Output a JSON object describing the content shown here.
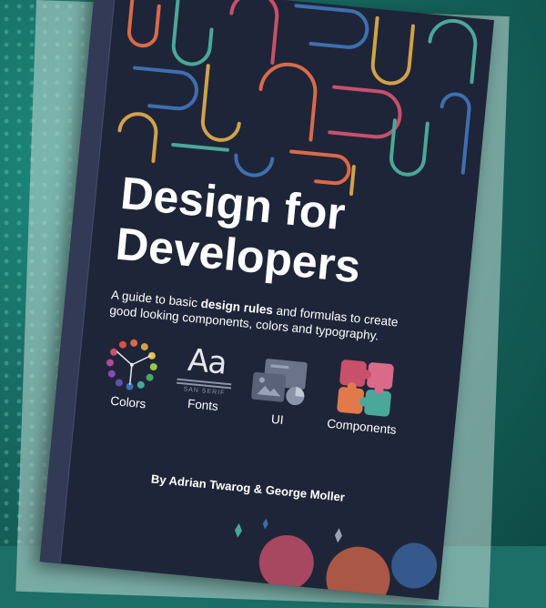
{
  "cover": {
    "title_line1": "Design for",
    "title_line2": "Developers",
    "subtitle_before": "A guide to basic ",
    "subtitle_bold": "design rules",
    "subtitle_after": " and formulas to create good looking components, colors and typography.",
    "features": [
      {
        "label": "Colors",
        "icon": "color-wheel-icon"
      },
      {
        "label": "Fonts",
        "icon": "fonts-icon",
        "aa": "Aa",
        "small": "SAN SERIF"
      },
      {
        "label": "UI",
        "icon": "ui-windows-icon"
      },
      {
        "label": "Components",
        "icon": "puzzle-icon"
      }
    ],
    "authors": "By Adrian Twarog & George Moller"
  },
  "colors": {
    "background": "#176a61",
    "cover": "#1f2538",
    "spine": "#323a55",
    "pattern": [
      "#d96a4a",
      "#4aa89a",
      "#3e6fb0",
      "#c9506a",
      "#d1a24a"
    ]
  }
}
